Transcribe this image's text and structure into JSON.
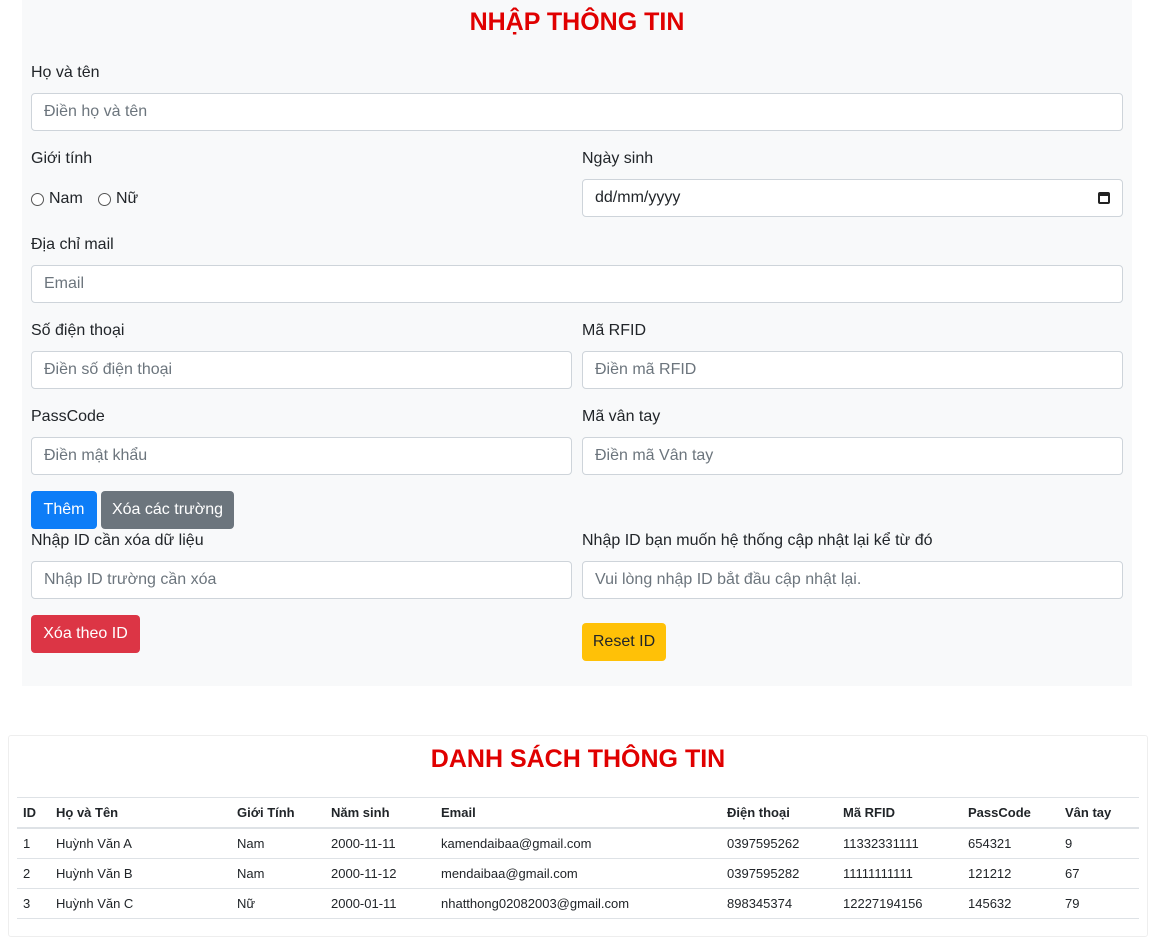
{
  "form": {
    "title": "NHẬP THÔNG TIN",
    "fullname": {
      "label": "Họ và tên",
      "placeholder": "Điền họ và tên"
    },
    "gender": {
      "label": "Giới tính",
      "options": [
        "Nam",
        "Nữ"
      ]
    },
    "dob": {
      "label": "Ngày sinh",
      "placeholder": "dd/mm/yyyy"
    },
    "email": {
      "label": "Địa chỉ mail",
      "placeholder": "Email"
    },
    "phone": {
      "label": "Số điện thoại",
      "placeholder": "Điền số điện thoại"
    },
    "rfid": {
      "label": "Mã RFID",
      "placeholder": "Điền mã RFID"
    },
    "passcode": {
      "label": "PassCode",
      "placeholder": "Điền mật khẩu"
    },
    "fingerprint": {
      "label": "Mã vân tay",
      "placeholder": "Điền mã Vân tay"
    },
    "add_label": "Thêm",
    "clear_label": "Xóa các trường",
    "delete_id": {
      "label": "Nhập ID cần xóa dữ liệu",
      "placeholder": "Nhập ID trường cần xóa",
      "button": "Xóa theo ID"
    },
    "reset_id": {
      "label": "Nhập ID bạn muốn hệ thống cập nhật lại kể từ đó",
      "placeholder": "Vui lòng nhập ID bắt đầu cập nhật lại.",
      "button": "Reset ID"
    }
  },
  "list": {
    "title": "DANH SÁCH THÔNG TIN",
    "columns": [
      "ID",
      "Họ và Tên",
      "Giới Tính",
      "Năm sinh",
      "Email",
      "Điện thoại",
      "Mã RFID",
      "PassCode",
      "Vân tay"
    ],
    "rows": [
      [
        "1",
        "Huỳnh Văn A",
        "Nam",
        "2000-11-11",
        "kamendaibaa@gmail.com",
        "0397595262",
        "11332331111",
        "654321",
        "9"
      ],
      [
        "2",
        "Huỳnh Văn B",
        "Nam",
        "2000-11-12",
        "mendaibaa@gmail.com",
        "0397595282",
        "11111111111",
        "121212",
        "67"
      ],
      [
        "3",
        "Huỳnh Văn C",
        "Nữ",
        "2000-01-11",
        "nhatthong02082003@gmail.com",
        "898345374",
        "12227194156",
        "145632",
        "79"
      ]
    ]
  },
  "colors": {
    "title_red": "#e00000",
    "primary": "#0d7df7",
    "secondary": "#6c757d",
    "danger": "#dc3545",
    "warning": "#ffc107"
  }
}
